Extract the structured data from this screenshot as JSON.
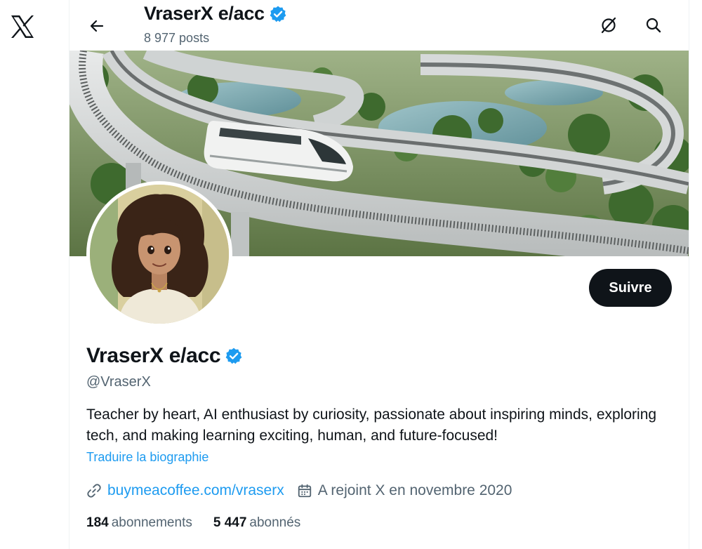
{
  "app": {
    "logo_icon": "x-logo-icon"
  },
  "header": {
    "title": "VraserX e/acc",
    "posts_count": "8 977 posts",
    "back_icon": "back-arrow-icon",
    "grok_icon": "grok-icon",
    "search_icon": "search-icon"
  },
  "profile": {
    "display_name": "VraserX e/acc",
    "handle": "@VraserX",
    "verified_icon": "verified-badge-icon",
    "bio": "Teacher by heart, AI enthusiast by curiosity, passionate about inspiring minds, exploring tech, and making learning exciting, human, and future-focused!",
    "translate_label": "Traduire la biographie",
    "website": "buymeacoffee.com/vraserx",
    "joined": "A rejoint X en novembre 2020",
    "follow_label": "Suivre",
    "following_count": "184",
    "following_label": "abonnements",
    "followers_count": "5 447",
    "followers_label": "abonnés"
  },
  "colors": {
    "accent": "#1d9bf0",
    "text_primary": "#0f1419",
    "text_secondary": "#536471",
    "button_dark": "#0f1419"
  }
}
